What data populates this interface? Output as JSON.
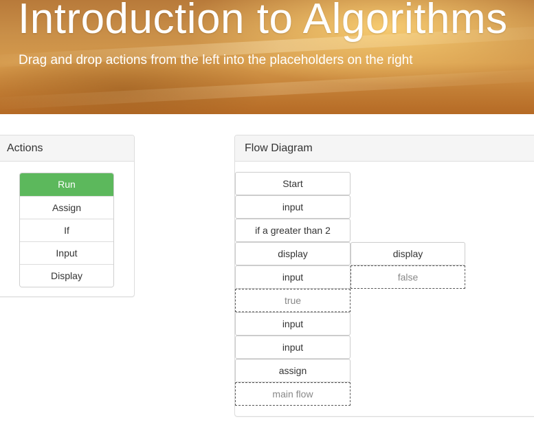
{
  "header": {
    "title": "Introduction to Algorithms",
    "subtitle": "Drag and drop actions from the left into the placeholders on the right"
  },
  "actions": {
    "heading": "Actions",
    "items": [
      {
        "label": "Run"
      },
      {
        "label": "Assign"
      },
      {
        "label": "If"
      },
      {
        "label": "Input"
      },
      {
        "label": "Display"
      }
    ]
  },
  "flow": {
    "heading": "Flow Diagram",
    "main": [
      {
        "label": "Start"
      },
      {
        "label": "input"
      },
      {
        "label": "if a greater than 2"
      },
      {
        "label": "display"
      },
      {
        "label": "input"
      },
      {
        "label": "true"
      },
      {
        "label": "input"
      },
      {
        "label": "input"
      },
      {
        "label": "assign"
      },
      {
        "label": "main flow"
      }
    ],
    "branch": [
      {
        "label": "display"
      },
      {
        "label": "false"
      }
    ]
  },
  "colors": {
    "accent_green": "#5cb85c",
    "panel_heading_bg": "#f5f5f5",
    "border": "#dddddd"
  }
}
